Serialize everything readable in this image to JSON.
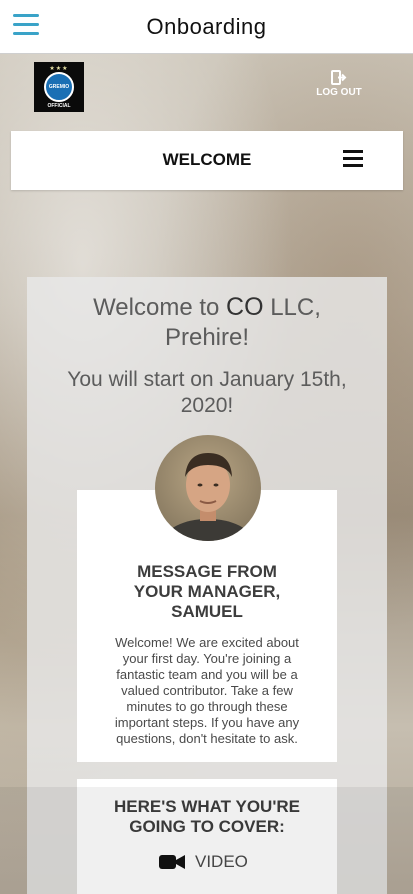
{
  "app": {
    "title": "Onboarding",
    "menu_icon": "hamburger-menu-icon"
  },
  "header": {
    "logo": {
      "name": "GREMIO",
      "subtitle": "OFFICIAL"
    },
    "logout_label": "LOG OUT",
    "logout_icon": "logout-icon"
  },
  "welcome_bar": {
    "title": "WELCOME",
    "menu_icon": "hamburger-menu-icon"
  },
  "main": {
    "greeting_prefix": "Welcome to",
    "company": "CO",
    "company_suffix": "LLC,",
    "greeting_name": "Prehire!",
    "start_date_line1": "You will start on January 15th,",
    "start_date_line2": "2020!"
  },
  "manager_card": {
    "title_line1": "MESSAGE FROM",
    "title_line2": "YOUR MANAGER,",
    "title_line3": "SAMUEL",
    "body_line1": "Welcome! We are excited about",
    "body_line2": "your first day. You're joining a",
    "body_line3": "fantastic team and you will be a",
    "body_line4": "valued contributor. Take a few",
    "body_line5": "minutes to go through these",
    "body_line6": "important steps. If you have any",
    "body_line7": "questions, don't hesitate to ask."
  },
  "cover_card": {
    "title_line1": "HERE'S WHAT YOU'RE",
    "title_line2": "GOING TO COVER:",
    "items": [
      {
        "label": "VIDEO",
        "icon": "video-camera-icon"
      }
    ]
  },
  "colors": {
    "accent": "#3aa3c8",
    "logo_blue": "#1a6fb4",
    "card": "#ffffff",
    "text_gray": "#5c5c5c"
  }
}
